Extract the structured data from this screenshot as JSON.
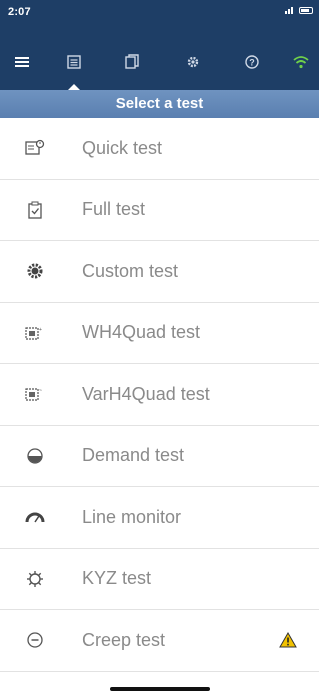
{
  "status_bar": {
    "time": "2:07"
  },
  "toolbar": {
    "buttons": [
      {
        "name": "menu",
        "icon": "hamburger-menu-icon"
      },
      {
        "name": "tests",
        "icon": "test-list-icon",
        "active": true
      },
      {
        "name": "results",
        "icon": "documents-icon"
      },
      {
        "name": "settings",
        "icon": "gear-icon"
      },
      {
        "name": "help",
        "icon": "help-icon"
      },
      {
        "name": "connection",
        "icon": "wifi-icon"
      }
    ],
    "wifi_color": "#6fd14a"
  },
  "title": "Select a test",
  "tests": [
    {
      "label": "Quick test",
      "icon": "quick-test-icon"
    },
    {
      "label": "Full test",
      "icon": "full-test-clipboard-icon"
    },
    {
      "label": "Custom test",
      "icon": "custom-test-gear-icon"
    },
    {
      "label": "WH4Quad test",
      "icon": "wh4quad-test-icon"
    },
    {
      "label": "VarH4Quad test",
      "icon": "varh4quad-test-icon"
    },
    {
      "label": "Demand test",
      "icon": "demand-test-icon"
    },
    {
      "label": "Line monitor",
      "icon": "line-monitor-gauge-icon"
    },
    {
      "label": "KYZ test",
      "icon": "kyz-test-icon"
    },
    {
      "label": "Creep test",
      "icon": "creep-test-icon",
      "warning": true
    }
  ],
  "colors": {
    "header_bg": "#1e3e66",
    "title_bar_bg": "#6284b4",
    "label_text": "#8a8a8a",
    "warning": "#f2c200"
  }
}
